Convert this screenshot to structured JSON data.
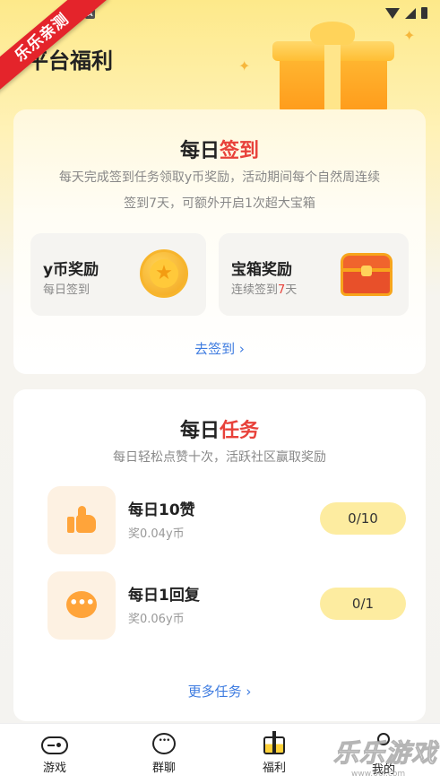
{
  "status_bar": {
    "a_badge": "A"
  },
  "ribbon": "乐乐亲测",
  "page_title": "平台福利",
  "signin": {
    "title_prefix": "每日",
    "title_highlight": "签到",
    "description_line1": "每天完成签到任务领取y币奖励，活动期间每个自然周连续",
    "description_line2": "签到7天，可额外开启1次超大宝箱",
    "coin_reward": {
      "title": "y币奖励",
      "subtitle": "每日签到"
    },
    "chest_reward": {
      "title": "宝箱奖励",
      "subtitle_prefix": "连续签到",
      "subtitle_days": "7",
      "subtitle_suffix": "天"
    },
    "link": "去签到 ›"
  },
  "tasks": {
    "title_prefix": "每日",
    "title_highlight": "任务",
    "description": "每日轻松点赞十次，活跃社区赢取奖励",
    "items": [
      {
        "title": "每日10赞",
        "reward": "奖0.04y币",
        "progress": "0/10",
        "icon": "thumbs-up-icon"
      },
      {
        "title": "每日1回复",
        "reward": "奖0.06y币",
        "progress": "0/1",
        "icon": "chat-bubble-icon"
      }
    ],
    "link": "更多任务 ›"
  },
  "tabbar": [
    {
      "label": "游戏",
      "icon": "gamepad-icon"
    },
    {
      "label": "群聊",
      "icon": "chat-icon"
    },
    {
      "label": "福利",
      "icon": "gift-icon"
    },
    {
      "label": "我的",
      "icon": "user-icon"
    }
  ],
  "watermark": {
    "text": "乐乐游戏",
    "url": "www.66l.com"
  },
  "colors": {
    "accent_red": "#e8413a",
    "link_blue": "#3d7be0",
    "progress_yellow": "#fdeca0",
    "icon_orange": "#ffa43a"
  }
}
